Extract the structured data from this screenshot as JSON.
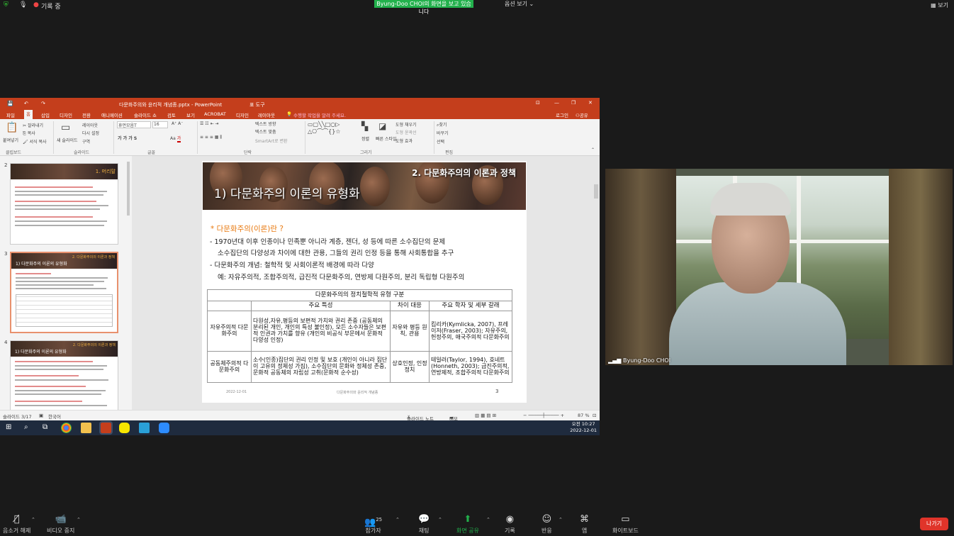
{
  "zoom_top": {
    "recording_label": "기록 중",
    "share_banner": "Byung-Doo CHOI의 화면을 보고 있습니다",
    "view_options": "옵션 보기 ⌄",
    "view_button": "보기"
  },
  "ppt": {
    "title": "다문화주의와 윤리적 개념종.pptx - PowerPoint",
    "contextual_tab": "표 도구",
    "login": "로그인",
    "share": "공유",
    "tabs": [
      "파일",
      "홈",
      "삽입",
      "디자인",
      "전환",
      "애니메이션",
      "슬라이드 쇼",
      "검토",
      "보기",
      "ACROBAT",
      "디자인",
      "레이아웃"
    ],
    "tell_me": "수행할 작업을 알려 주세요.",
    "ribbon": {
      "paste": "붙여넣기",
      "cut": "잘라내기",
      "copy": "복사",
      "format_painter": "서식 복사",
      "new_slide": "새 슬라이드",
      "layout": "레이아웃",
      "reset": "다시 설정",
      "section": "구역",
      "font_name": "휴먼모음T",
      "font_size": "16",
      "text_direction": "텍스트 방향",
      "text_align": "텍스트 맞춤",
      "smartart": "SmartArt로 변환",
      "arrange": "정렬",
      "quick_styles": "빠른 스타일",
      "shape_fill": "도형 채우기",
      "shape_outline": "도형 윤곽선",
      "shape_effects": "도형 효과",
      "find": "찾기",
      "replace": "바꾸기",
      "select": "선택",
      "groups": [
        "클립보드",
        "슬라이드",
        "글꼴",
        "단락",
        "그리기",
        "편집"
      ]
    },
    "thumbs": {
      "nums": [
        "2",
        "3",
        "4"
      ],
      "titles": [
        "1. 머리말",
        "2. 다문화주의의 이론과 정책",
        "2. 다문화주의의 이론과 정책"
      ],
      "subtitles": [
        "",
        "1) 다문화주의 이론의 유형화",
        "1) 다문화주의 이론의 유형화"
      ]
    },
    "slide": {
      "title_sub": "2. 다문화주의의 이론과 정책",
      "title_main": "1) 다문화주의 이론의 유형화",
      "question": "* 다문화주의(이론)란 ?",
      "line1": "- 1970년대 이후 인종이나 민족뿐 아니라 계층, 젠더, 성 등에 따른 소수집단의 문제",
      "line2": "소수집단의 다양성과 차이에 대한 관용, 그들의 권리 인정 등을 통해 사회통합을 추구",
      "line3": "- 다문화주의 개념: 철학적 및 사회이론적 배경에 따라 다양",
      "line4": "예: 자유주의적, 조합주의적, 급진적 다문화주의, 연방제 다원주의, 분리 독립형 다원주의",
      "table": {
        "caption": "다문화주의의 정치철학적 유형 구분",
        "headers": [
          "",
          "주요 특성",
          "차이 대응",
          "주요 학자 및 세부 갈래"
        ],
        "rows": [
          [
            "자유주의적 다문화주의",
            "다원성,자유,평등의 보편적 가치와 권리 존중 (공동체의 분리된 개인, 개인의 특성 불인정), 모든 소수자들은 보편적 인권과 가치를 향유 (개인의 비공식 부문에서 문화적 다양성 인정)",
            "자유와 평등 원칙, 관용",
            "킴리카(Kymlicka, 2007), 프레이저(Fraser, 2003); 자유주의, 헌정주의, 애국주의적 다문화주의"
          ],
          [
            "공동체주의적 다문화주의",
            "소수(인종)집단의 권리 인정 및 보호 (개인이 아니라 집단이 고유의 정체성 가짐), 소수집단의 문화와 정체성 존중, 문화적 공동체의 자립성 고취(문화적 순수성)",
            "상호인정, 인정 정치",
            "테일러(Taylor, 1994), 호네트(Honneth, 2003); 급진주의적, 연방제적, 조합주의적 다문화주의"
          ]
        ]
      },
      "footer_date": "2022-12-01",
      "footer_mid": "다문화주의와 윤리적 개념종",
      "page": "3"
    },
    "status": {
      "slide": "슬라이드 3/17",
      "lang": "한국어",
      "notes": "슬라이드 노트",
      "comments": "메모",
      "zoom": "87 %"
    },
    "taskbar": {
      "time": "오전 10:27",
      "date": "2022-12-01"
    }
  },
  "video": {
    "name": "Byung-Doo CHOI"
  },
  "bottom": {
    "mute": "음소거 해제",
    "video": "비디오 중지",
    "participants": "참가자",
    "participants_count": "25",
    "chat": "채팅",
    "share": "화면 공유",
    "record": "기록",
    "reactions": "반응",
    "apps": "앱",
    "whiteboard": "화이트보드",
    "leave": "나가기"
  }
}
